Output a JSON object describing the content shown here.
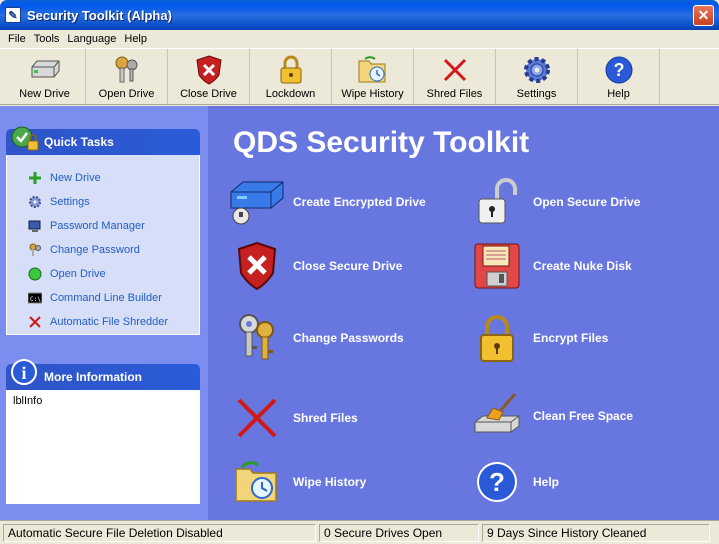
{
  "window": {
    "title": "Security Toolkit (Alpha)"
  },
  "menu": [
    "File",
    "Tools",
    "Language",
    "Help"
  ],
  "toolbar": [
    {
      "label": "New Drive",
      "icon": "drive-icon"
    },
    {
      "label": "Open Drive",
      "icon": "keys-icon"
    },
    {
      "label": "Close Drive",
      "icon": "shield-x-icon"
    },
    {
      "label": "Lockdown",
      "icon": "padlock-icon"
    },
    {
      "label": "Wipe History",
      "icon": "folder-history-icon"
    },
    {
      "label": "Shred Files",
      "icon": "red-x-icon"
    },
    {
      "label": "Settings",
      "icon": "gear-icon"
    },
    {
      "label": "Help",
      "icon": "help-icon"
    }
  ],
  "quick_tasks": {
    "title": "Quick Tasks",
    "items": [
      {
        "label": "New Drive",
        "icon": "plus-icon"
      },
      {
        "label": "Settings",
        "icon": "gear-icon"
      },
      {
        "label": "Password Manager",
        "icon": "monitor-icon"
      },
      {
        "label": "Change Password",
        "icon": "keys-icon"
      },
      {
        "label": "Open Drive",
        "icon": "green-dot-icon"
      },
      {
        "label": "Command Line Builder",
        "icon": "console-icon"
      },
      {
        "label": "Automatic File Shredder",
        "icon": "red-x-icon"
      }
    ]
  },
  "more_info": {
    "title": "More Information",
    "text": "lblInfo"
  },
  "main": {
    "title": "QDS Security Toolkit",
    "actions": [
      {
        "label": "Create Encrypted Drive",
        "icon": "encrypted-drive-icon"
      },
      {
        "label": "Open Secure Drive",
        "icon": "open-padlock-icon"
      },
      {
        "label": "Close Secure Drive",
        "icon": "shield-x-icon"
      },
      {
        "label": "Create Nuke Disk",
        "icon": "floppy-icon"
      },
      {
        "label": "Change Passwords",
        "icon": "keys-icon"
      },
      {
        "label": "Encrypt Files",
        "icon": "padlock-icon"
      },
      {
        "label": "Shred Files",
        "icon": "red-x-icon"
      },
      {
        "label": "Clean Free Space",
        "icon": "broom-drive-icon"
      },
      {
        "label": "Wipe History",
        "icon": "folder-history-icon"
      },
      {
        "label": "Help",
        "icon": "help-icon"
      }
    ]
  },
  "status": [
    "Automatic Secure File Deletion Disabled",
    "0 Secure Drives Open",
    "9 Days Since History Cleaned"
  ]
}
